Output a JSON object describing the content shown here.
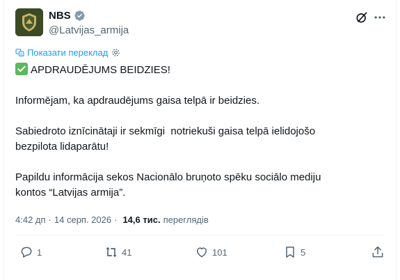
{
  "account": {
    "name": "NBS",
    "handle": "@Latvijas_armija"
  },
  "translate": {
    "label": "Показати переклад"
  },
  "tweet": {
    "lines": [
      "APDRAUDĒJUMS BEIDZIES!",
      "",
      "Informējam, ka apdraudējums gaisa telpā ir beidzies.",
      "",
      "Sabiedroto iznīcinātaji ir sekmīgi  notriekuši gaisa telpā ielidojošo",
      "bezpilota lidaparātu!",
      "",
      "Papildu informācija sekos Nacionālo bruņoto spēku sociālo mediju",
      "kontos “Latvijas armija”."
    ],
    "heading_emoji": "check-mark-button-emoji"
  },
  "meta": {
    "time": "4:42 дп",
    "separator": "·",
    "date": "14 серп. 2026",
    "views_count": "14,6 тис.",
    "views_label": "переглядів"
  },
  "actions": {
    "replies": "1",
    "retweets": "41",
    "likes": "101",
    "bookmarks": "5"
  },
  "colors": {
    "accent": "#1d9bf0",
    "text": "#0f1419",
    "secondary": "#536471",
    "verified": "#829aab"
  }
}
